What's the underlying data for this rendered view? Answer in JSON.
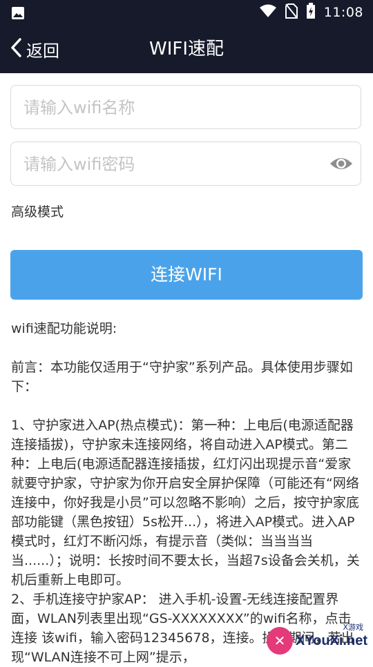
{
  "status_bar": {
    "time": "11:08",
    "icons": [
      "image-icon",
      "wifi-icon",
      "no-sim-icon",
      "battery-charging-icon"
    ]
  },
  "nav": {
    "back_label": "返回",
    "title": "WIFI速配"
  },
  "form": {
    "ssid_placeholder": "请输入wifi名称",
    "password_placeholder": "请输入wifi密码",
    "advanced_label": "高级模式",
    "connect_label": "连接WIFI"
  },
  "description": {
    "heading": "wifi速配功能说明:",
    "intro": "前言：本功能仅适用于“守护家”系列产品。具体使用步骤如下：",
    "step1": "1、守护家进入AP(热点模式)：第一种：上电后(电源适配器连接插拔)，守护家未连接网络，将自动进入AP模式。第二种：上电后(电源适配器连接插拔，红灯闪出现提示音“爱家就要守护家，守护家为你开启安全屏护保障（可能还有“网络连接中，你好我是小员”可以忽略不影响）之后，按守护家底部功能键（黑色按钮）5s松开...），将进入AP模式。进入AP模式时，红灯不断闪烁，有提示音（类似：当当当当当......）；说明：长按时间不要太长，当超7s设备会关机，关机后重新上电即可。",
    "step2": "2、手机连接守护家AP： 进入手机-设置-无线连接配置界面，WLAN列表里出现“GS-XXXXXXXX”的wifi名称，点击连接 该wifi，输入密码12345678，连接。操作期间，若出现“WLAN连接不可上网”提示，"
  },
  "watermark": {
    "text": "XYouXi.net",
    "small": "X游戏"
  },
  "colors": {
    "bar_bg": "#161a2b",
    "button_bg": "#4aa3ea"
  }
}
